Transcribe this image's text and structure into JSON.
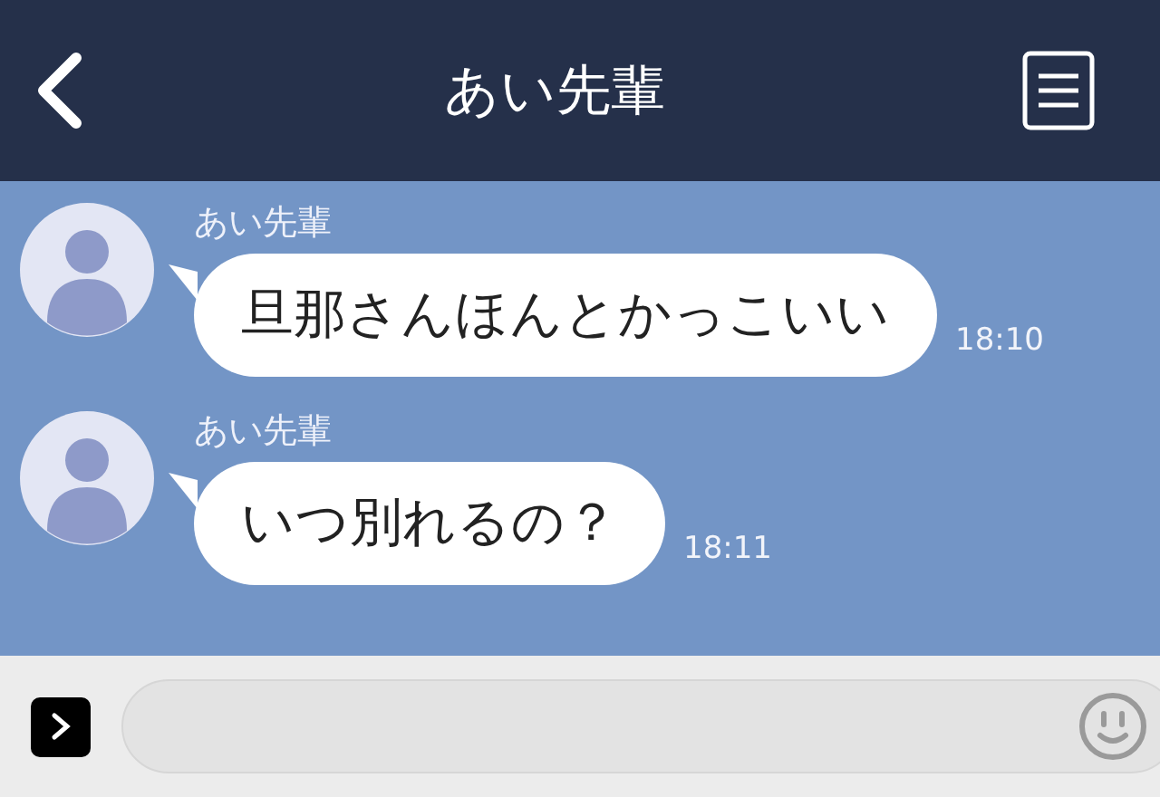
{
  "header": {
    "title": "あい先輩"
  },
  "messages": [
    {
      "sender": "あい先輩",
      "text": "旦那さんほんとかっこいい",
      "time": "18:10"
    },
    {
      "sender": "あい先輩",
      "text": "いつ別れるの？",
      "time": "18:11"
    }
  ]
}
